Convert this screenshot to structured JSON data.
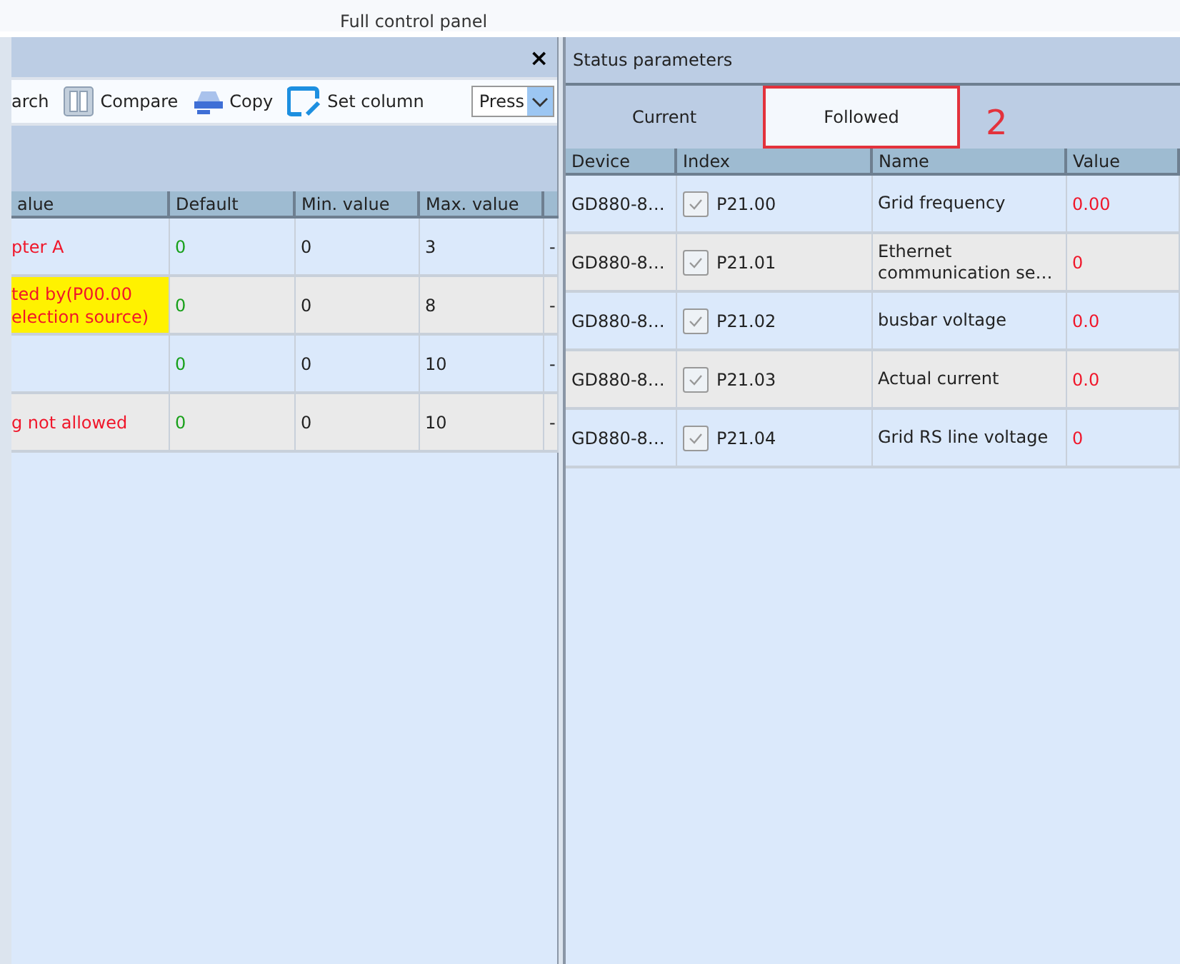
{
  "top_bar": {
    "title": "Full control panel"
  },
  "left_panel": {
    "close": "×",
    "toolbar": [
      {
        "kind": "text",
        "label": "arch"
      },
      {
        "kind": "compare",
        "label": "Compare"
      },
      {
        "kind": "copy",
        "label": "Copy"
      },
      {
        "kind": "setcol",
        "label": "Set column"
      },
      {
        "kind": "select",
        "label": "Press"
      }
    ],
    "table": {
      "columns": [
        "alue",
        "Default",
        "Min. value",
        "Max. value"
      ],
      "rows": [
        {
          "cells": [
            "pter A",
            "0",
            "0",
            "3",
            "-"
          ],
          "highlighted": false
        },
        {
          "cells": [
            "ted by(P00.00\nelection source)",
            "0",
            "0",
            "8",
            "-"
          ],
          "highlighted": true
        },
        {
          "cells": [
            "",
            "0",
            "0",
            "10",
            "-"
          ],
          "highlighted": false
        },
        {
          "cells": [
            "g not allowed",
            "0",
            "0",
            "10",
            "-"
          ],
          "highlighted": false
        }
      ]
    }
  },
  "right_panel": {
    "title": "Status parameters",
    "tabs": [
      {
        "label": "Current",
        "selected": false
      },
      {
        "label": "Followed",
        "selected": true
      }
    ],
    "annotation": "2",
    "table": {
      "columns": [
        "Device",
        "Index",
        "Name",
        "Value"
      ],
      "rows": [
        {
          "device": "GD880-8…",
          "checked": true,
          "index": "P21.00",
          "name": "Grid frequency",
          "value": "0.00"
        },
        {
          "device": "GD880-8…",
          "checked": true,
          "index": "P21.01",
          "name": "Ethernet\ncommunication se…",
          "value": "0"
        },
        {
          "device": "GD880-8…",
          "checked": true,
          "index": "P21.02",
          "name": "busbar voltage",
          "value": "0.0"
        },
        {
          "device": "GD880-8…",
          "checked": true,
          "index": "P21.03",
          "name": "Actual current",
          "value": "0.0"
        },
        {
          "device": "GD880-8…",
          "checked": true,
          "index": "P21.04",
          "name": "Grid RS line voltage",
          "value": "0"
        }
      ]
    }
  }
}
